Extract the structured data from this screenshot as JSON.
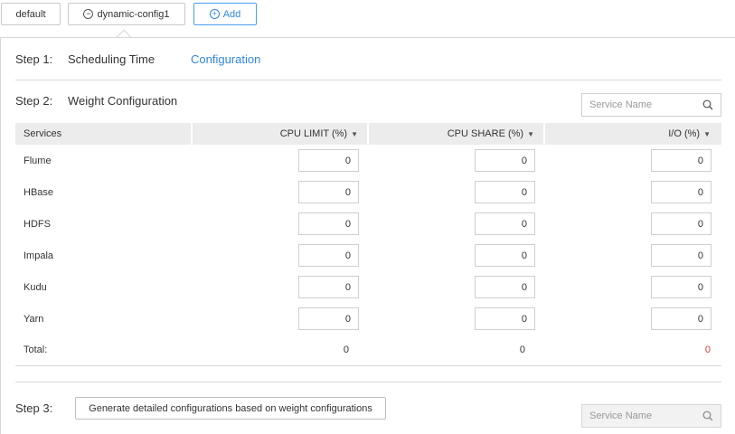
{
  "tabs": [
    {
      "label": "default"
    },
    {
      "label": "dynamic-config1"
    },
    {
      "label": "Add"
    }
  ],
  "step1": {
    "label": "Step 1:",
    "title": "Scheduling Time",
    "link": "Configuration"
  },
  "step2": {
    "label": "Step 2:",
    "title": "Weight Configuration",
    "search_placeholder": "Service Name"
  },
  "table": {
    "headers": [
      "Services",
      "CPU LIMIT (%)",
      "CPU SHARE (%)",
      "I/O (%)"
    ],
    "rows": [
      {
        "name": "Flume",
        "cpu_limit": "0",
        "cpu_share": "0",
        "io": "0"
      },
      {
        "name": "HBase",
        "cpu_limit": "0",
        "cpu_share": "0",
        "io": "0"
      },
      {
        "name": "HDFS",
        "cpu_limit": "0",
        "cpu_share": "0",
        "io": "0"
      },
      {
        "name": "Impala",
        "cpu_limit": "0",
        "cpu_share": "0",
        "io": "0"
      },
      {
        "name": "Kudu",
        "cpu_limit": "0",
        "cpu_share": "0",
        "io": "0"
      },
      {
        "name": "Yarn",
        "cpu_limit": "0",
        "cpu_share": "0",
        "io": "0"
      }
    ],
    "total": {
      "label": "Total:",
      "cpu_limit": "0",
      "cpu_share": "0",
      "io": "0"
    }
  },
  "step3": {
    "label": "Step 3:",
    "button": "Generate detailed configurations based on weight configurations",
    "search_placeholder": "Service Name"
  },
  "colors": {
    "accent": "#2f86e0",
    "error": "#e53935",
    "header_bg": "#ececec"
  },
  "icons": {
    "tab_dyn": "minus-circle-icon",
    "tab_add": "plus-circle-icon",
    "search": "search-icon",
    "sort": "caret-down-icon"
  }
}
